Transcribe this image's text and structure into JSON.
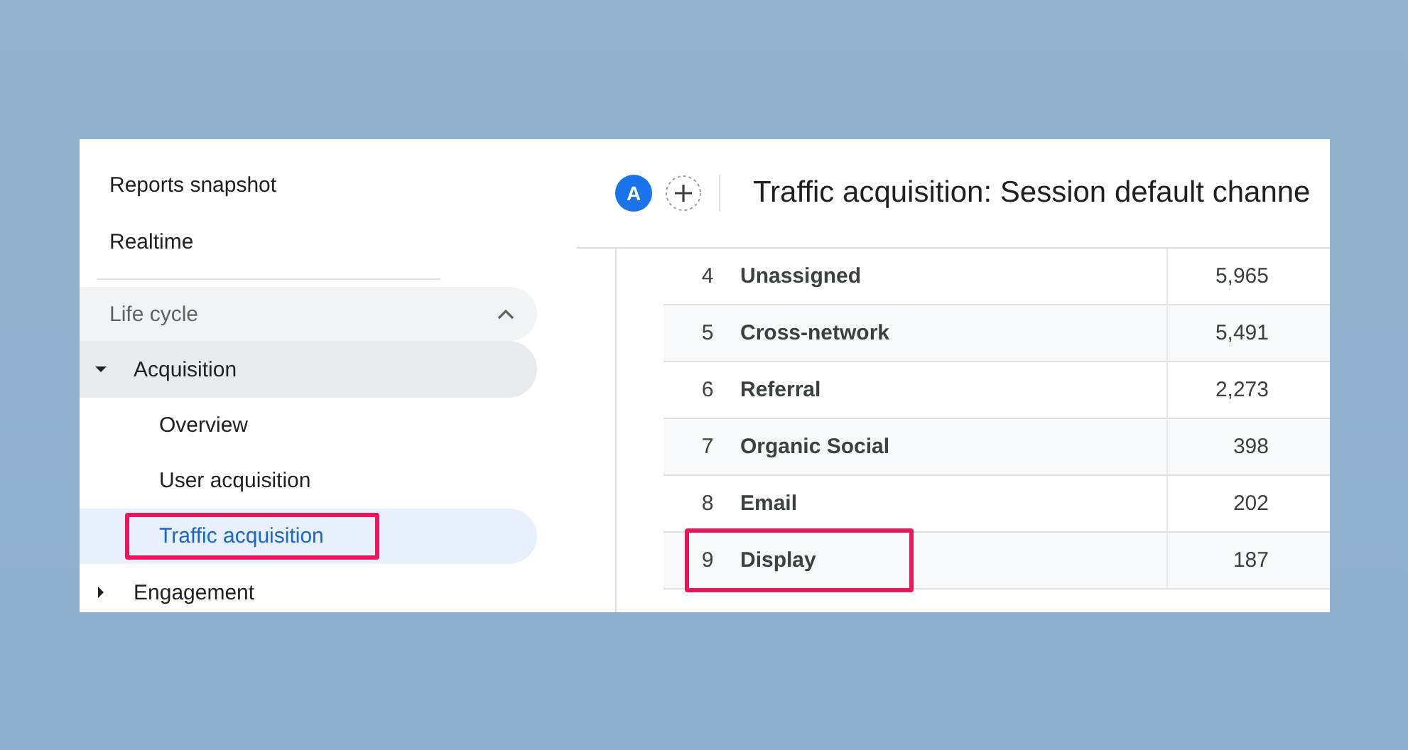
{
  "sidebar": {
    "items": [
      {
        "label": "Reports snapshot",
        "selected": false
      },
      {
        "label": "Realtime",
        "selected": false
      }
    ],
    "section": {
      "label": "Life cycle",
      "expanded": true,
      "groups": [
        {
          "label": "Acquisition",
          "expanded": true,
          "children": [
            {
              "label": "Overview",
              "selected": false,
              "highlighted": false
            },
            {
              "label": "User acquisition",
              "selected": false,
              "highlighted": false
            },
            {
              "label": "Traffic acquisition",
              "selected": true,
              "highlighted": true
            }
          ]
        },
        {
          "label": "Engagement",
          "expanded": false
        }
      ]
    }
  },
  "header": {
    "avatar": "A",
    "title": "Traffic acquisition: Session default channe"
  },
  "table": {
    "rows": [
      {
        "rank": "4",
        "channel": "Unassigned",
        "value": "5,965",
        "highlighted": false
      },
      {
        "rank": "5",
        "channel": "Cross-network",
        "value": "5,491",
        "highlighted": false
      },
      {
        "rank": "6",
        "channel": "Referral",
        "value": "2,273",
        "highlighted": false
      },
      {
        "rank": "7",
        "channel": "Organic Social",
        "value": "398",
        "highlighted": false
      },
      {
        "rank": "8",
        "channel": "Email",
        "value": "202",
        "highlighted": false
      },
      {
        "rank": "9",
        "channel": "Display",
        "value": "187",
        "highlighted": true
      }
    ]
  }
}
